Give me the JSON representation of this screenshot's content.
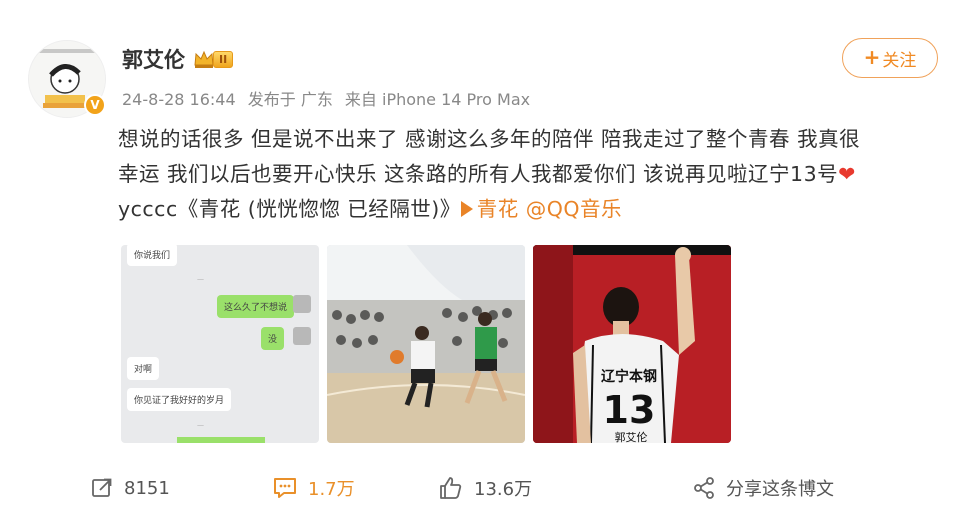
{
  "user": {
    "name": "郭艾伦",
    "level_badge": "II",
    "verified_mark": "V"
  },
  "meta": {
    "time": "24-8-28 16:44",
    "posted_in": "发布于 广东",
    "device": "来自 iPhone 14 Pro Max"
  },
  "follow_button": {
    "label": "关注"
  },
  "post": {
    "line1": "想说的话很多 但是说不出来了 感谢这么多年的陪伴 陪我走过了整个青春 我真很",
    "line2": "幸运 我们以后也要开心快乐 这条路的所有人我都爱你们 该说再见啦辽宁13号",
    "heart_emoji": "❤",
    "line3_prefix": "ycccc《青花 (恍恍惚惚 已经隔世)》",
    "music_link": "青花",
    "music_source": "@QQ音乐"
  },
  "images": {
    "chat_lines": [
      "你说我们",
      "这么久了不想说",
      "没",
      "对啊",
      "你见证了我好好的岁月"
    ],
    "jersey_team": "辽宁本钢",
    "jersey_number": "13",
    "jersey_name": "郭艾伦"
  },
  "actions": {
    "repost_count": "8151",
    "comment_count": "1.7万",
    "like_count": "13.6万",
    "share_label": "分享这条博文"
  },
  "colors": {
    "accent": "#f08a24",
    "link": "#e98428",
    "heart": "#e8392e",
    "meta": "#888888",
    "text": "#333333"
  }
}
